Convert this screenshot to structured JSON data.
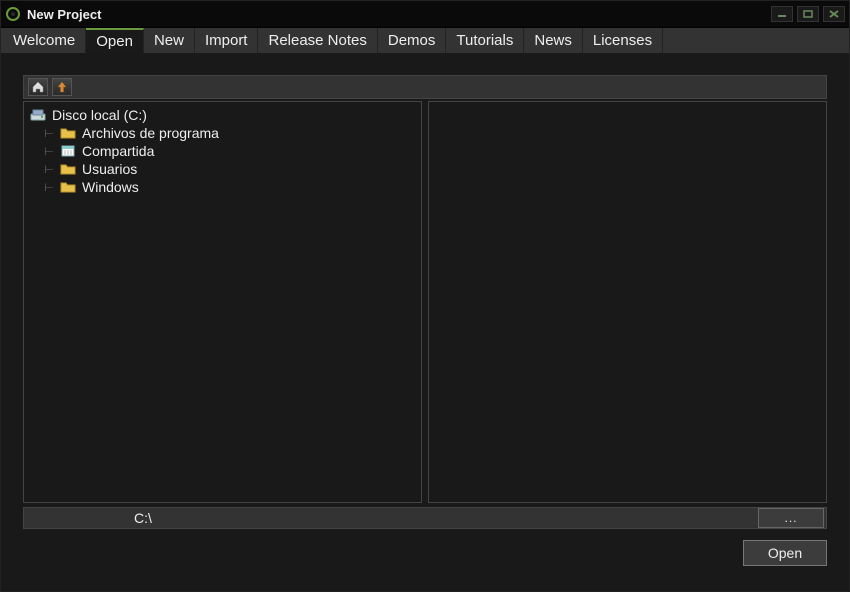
{
  "window": {
    "title": "New Project"
  },
  "tabs": [
    {
      "label": "Welcome"
    },
    {
      "label": "Open"
    },
    {
      "label": "New"
    },
    {
      "label": "Import"
    },
    {
      "label": "Release Notes"
    },
    {
      "label": "Demos"
    },
    {
      "label": "Tutorials"
    },
    {
      "label": "News"
    },
    {
      "label": "Licenses"
    }
  ],
  "active_tab_index": 1,
  "tree": {
    "root_label": "Disco local (C:)",
    "children": [
      {
        "label": "Archivos de programa",
        "icon": "folder"
      },
      {
        "label": "Compartida",
        "icon": "calendar"
      },
      {
        "label": "Usuarios",
        "icon": "folder"
      },
      {
        "label": "Windows",
        "icon": "folder"
      }
    ]
  },
  "path": "C:\\",
  "browse_label": "...",
  "open_button_label": "Open"
}
